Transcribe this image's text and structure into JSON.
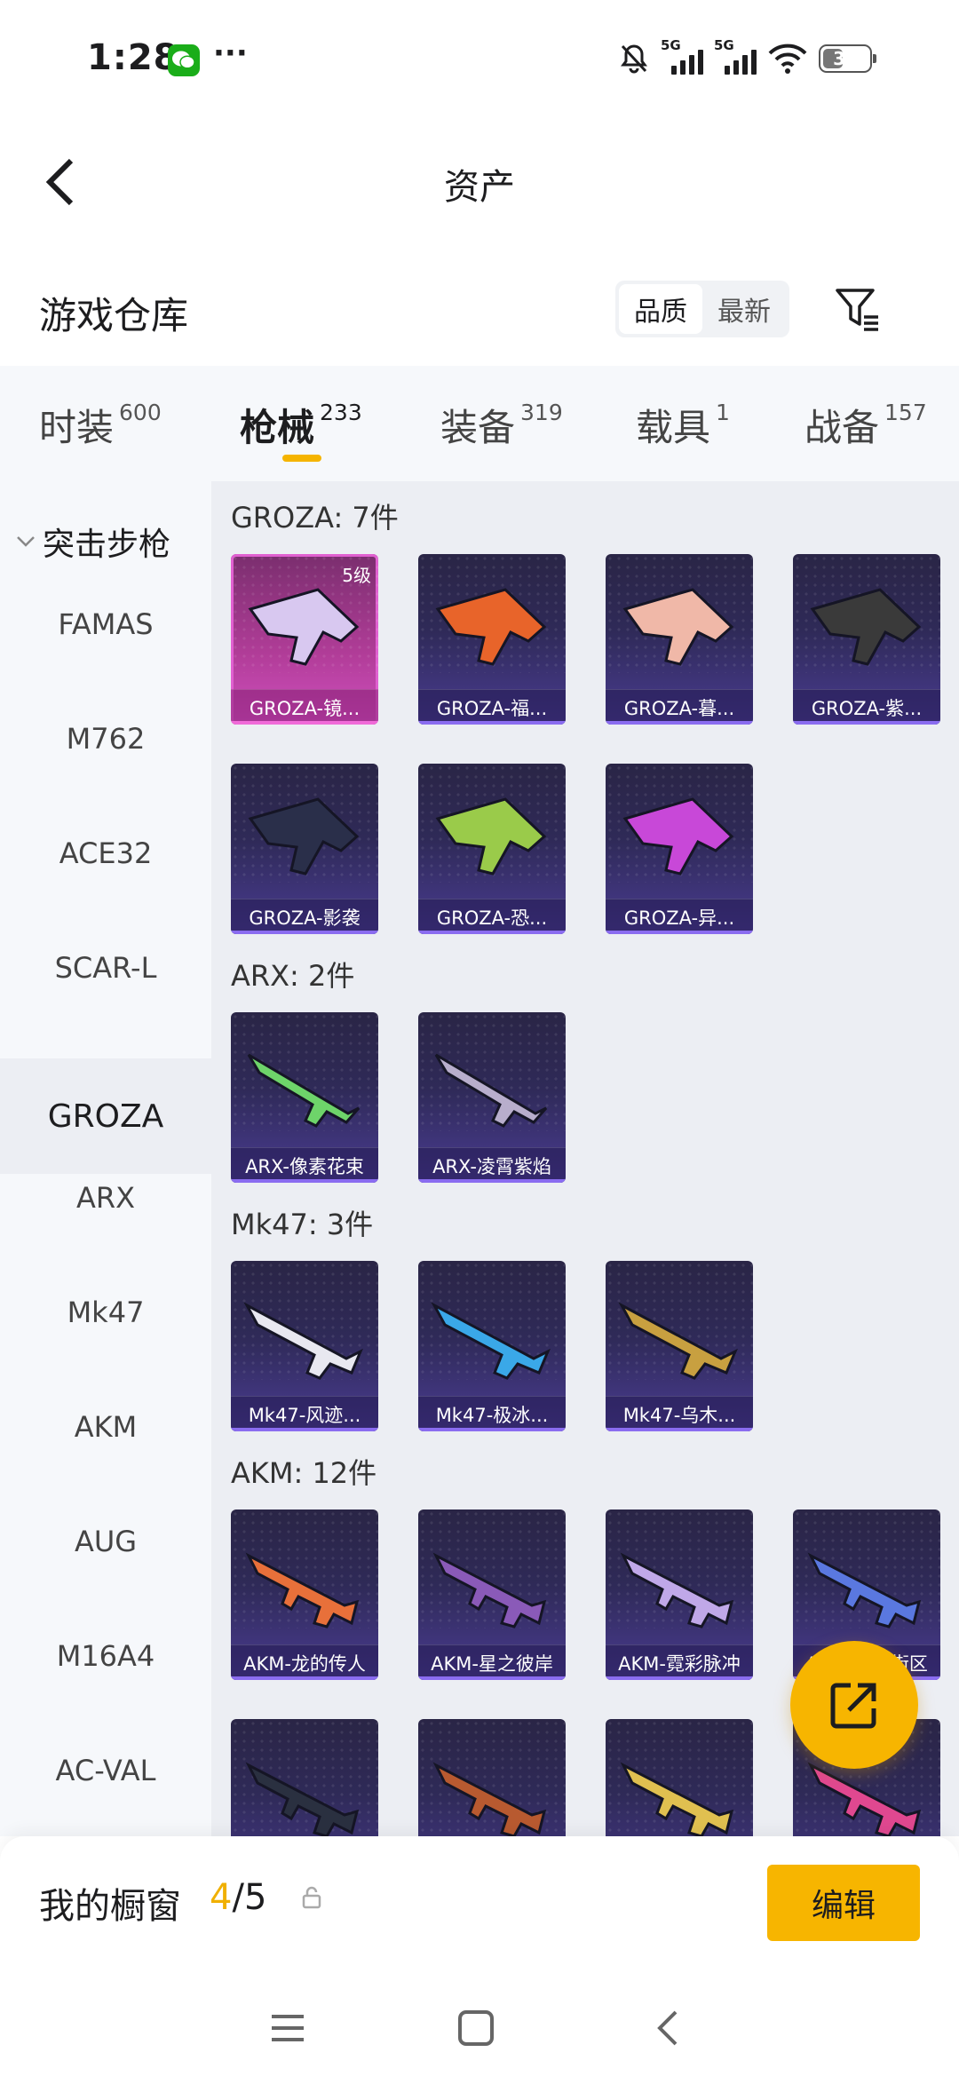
{
  "status_bar": {
    "time": "1:28",
    "more": "···",
    "net1": "5G",
    "net2": "5G",
    "battery": "33"
  },
  "header": {
    "title": "资产"
  },
  "warehouse": {
    "title": "游戏仓库",
    "sort_options": [
      "品质",
      "最新"
    ],
    "sort_active": "品质"
  },
  "categories": [
    {
      "name": "时装",
      "count": "600"
    },
    {
      "name": "枪械",
      "count": "233",
      "active": true
    },
    {
      "name": "装备",
      "count": "319"
    },
    {
      "name": "载具",
      "count": "1"
    },
    {
      "name": "战备",
      "count": "157"
    }
  ],
  "sidebar": {
    "group": "突击步枪",
    "items": [
      "FAMAS",
      "M762",
      "ACE32",
      "SCAR-L",
      "GROZA",
      "ARX",
      "Mk47",
      "AKM",
      "AUG",
      "M16A4",
      "AC-VAL"
    ],
    "active": "GROZA"
  },
  "sections": [
    {
      "title": "GROZA: 7件",
      "items": [
        {
          "name": "GROZA-镜...",
          "level": "5级",
          "style": "pink",
          "color": "#d8c8f0"
        },
        {
          "name": "GROZA-福...",
          "color": "#e8642a"
        },
        {
          "name": "GROZA-暮...",
          "color": "#f0b8a8"
        },
        {
          "name": "GROZA-紫...",
          "color": "#3a3a3a"
        },
        {
          "name": "GROZA-影袭",
          "color": "#2a2f4a"
        },
        {
          "name": "GROZA-恐...",
          "color": "#9acb4a"
        },
        {
          "name": "GROZA-异...",
          "color": "#c848d8"
        }
      ]
    },
    {
      "title": "ARX: 2件",
      "items": [
        {
          "name": "ARX-像素花束",
          "color": "#6ed46a"
        },
        {
          "name": "ARX-凌霄紫焰",
          "color": "#b8aecc"
        }
      ]
    },
    {
      "title": "Mk47: 3件",
      "items": [
        {
          "name": "Mk47-风迹...",
          "color": "#e8e8f0"
        },
        {
          "name": "Mk47-极冰...",
          "color": "#3aa8e8"
        },
        {
          "name": "Mk47-乌木...",
          "color": "#c8a040"
        }
      ]
    },
    {
      "title": "AKM: 12件",
      "items": [
        {
          "name": "AKM-龙的传人",
          "color": "#e8703a"
        },
        {
          "name": "AKM-星之彼岸",
          "color": "#8a5ab8"
        },
        {
          "name": "AKM-霓彩脉冲",
          "color": "#c0a8e8"
        },
        {
          "name": "AKM-潮流街区",
          "color": "#5a78e0"
        },
        {
          "name": "",
          "color": "#2a3040"
        },
        {
          "name": "",
          "color": "#b85a30"
        },
        {
          "name": "",
          "color": "#e0c050"
        },
        {
          "name": "",
          "color": "#e04890"
        }
      ]
    }
  ],
  "bottom_bar": {
    "label": "我的橱窗",
    "current": "4",
    "separator": "/",
    "max": "5",
    "edit_label": "编辑"
  },
  "colors": {
    "accent": "#f7b500",
    "card_bg": "#2f2a58",
    "card_pink": "#b23d99"
  }
}
